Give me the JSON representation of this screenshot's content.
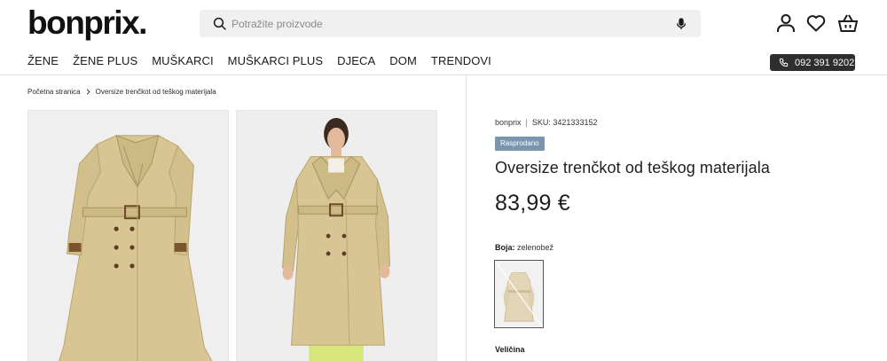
{
  "header": {
    "logo": "bonprix.",
    "search_placeholder": "Potražite proizvode",
    "phone": "092 391 9202"
  },
  "nav": {
    "items": [
      "ŽENE",
      "ŽENE PLUS",
      "MUŠKARCI",
      "MUŠKARCI PLUS",
      "DJECA",
      "DOM",
      "TRENDOVI"
    ]
  },
  "breadcrumb": {
    "home": "Početna stranica",
    "current": "Oversize trenčkot od teškog materijala"
  },
  "product": {
    "brand": "bonprix",
    "sku_label": "SKU:",
    "sku": "3421333152",
    "badge": "Rasprodano",
    "title": "Oversize trenčkot od teškog materijala",
    "price": "83,99 €",
    "color_label": "Boja:",
    "color_value": "zelenobež",
    "size_label": "Veličina"
  },
  "colors": {
    "badge_bg": "#7a95ad",
    "coat": "#d9c594",
    "pants": "#d7e57d"
  }
}
